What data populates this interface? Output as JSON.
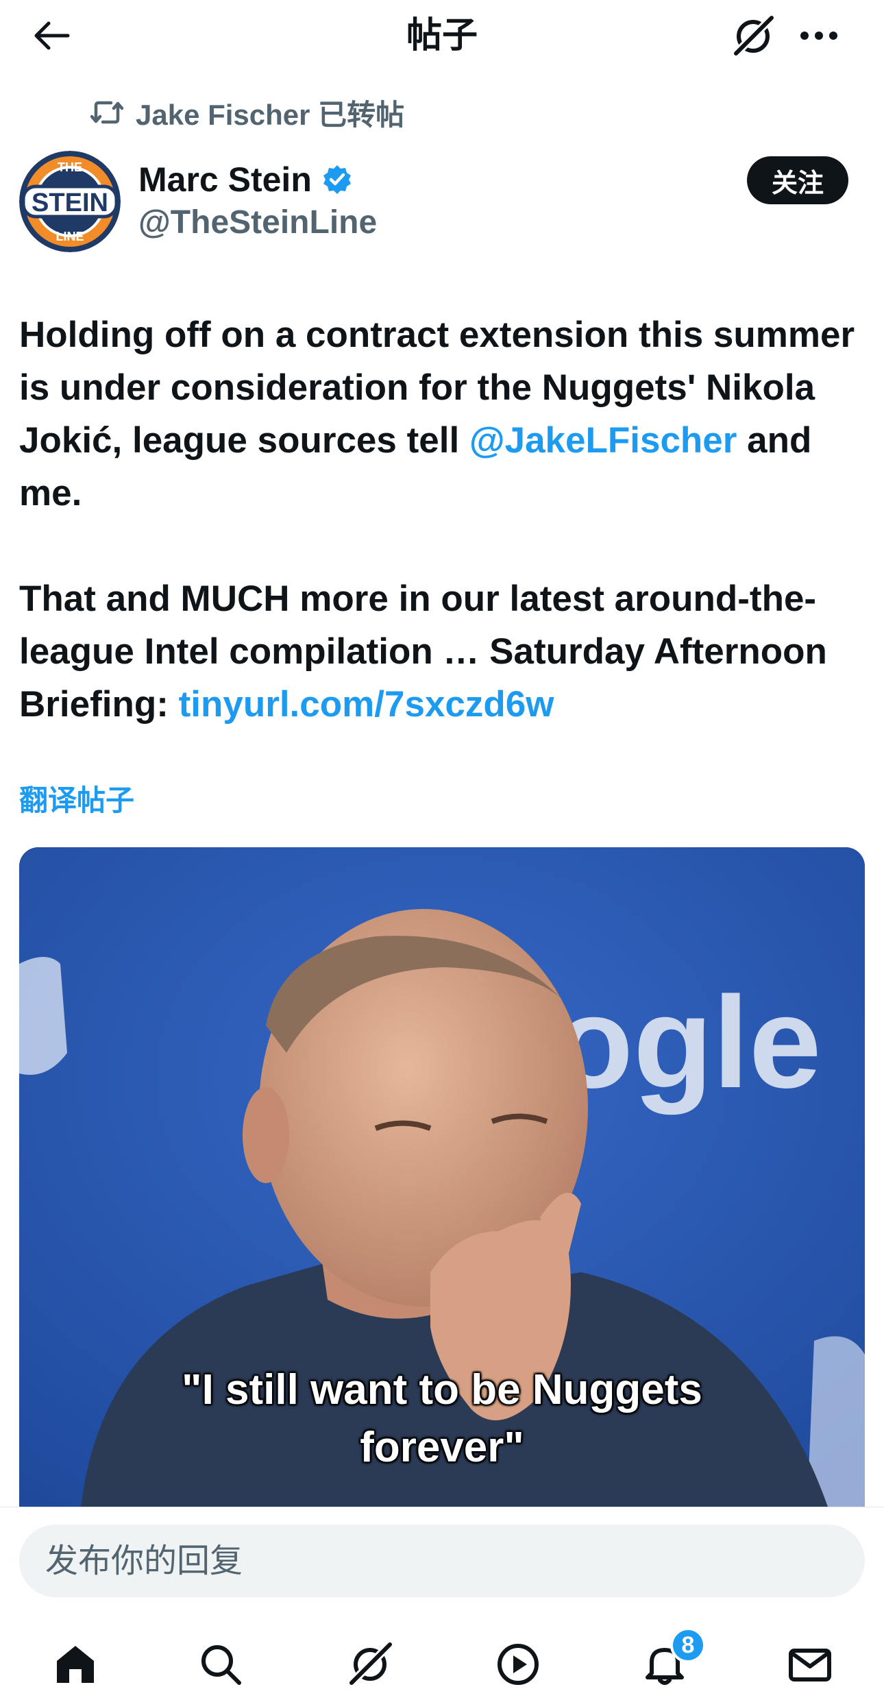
{
  "header": {
    "title": "帖子",
    "back_icon": "arrow-left-icon",
    "grok_icon": "grok-icon",
    "more_icon": "more-horizontal-icon"
  },
  "repost": {
    "icon": "repost-icon",
    "text": "Jake Fischer 已转帖"
  },
  "author": {
    "name": "Marc Stein",
    "handle": "@TheSteinLine",
    "verified": true,
    "avatar_text_top": "THE",
    "avatar_text_main": "STEIN",
    "avatar_text_bottom": "LINE",
    "follow_label": "关注"
  },
  "tweet": {
    "p1_text": "Holding off on a contract extension this summer is under consideration for the Nuggets' Nikola Jokić, league sources tell ",
    "p1_mention": "@JakeLFischer",
    "p1_tail": " and me.",
    "p2_text": "That and MUCH more in our latest around-the-league Intel compilation … Saturday Afternoon Briefing: ",
    "p2_link": "tinyurl.com/7sxczd6w",
    "translate_label": "翻译帖子"
  },
  "media": {
    "backdrop_text": "ogle",
    "caption_line1": "\"I still want to be Nuggets",
    "caption_line2": "forever\""
  },
  "reply": {
    "placeholder": "发布你的回复"
  },
  "nav": {
    "items": [
      "home-icon",
      "search-icon",
      "grok-icon",
      "video-play-icon",
      "notifications-icon",
      "messages-icon"
    ],
    "notification_count": "8"
  },
  "colors": {
    "accent": "#1d9bf0",
    "text": "#0f1419",
    "secondary": "#536471"
  }
}
